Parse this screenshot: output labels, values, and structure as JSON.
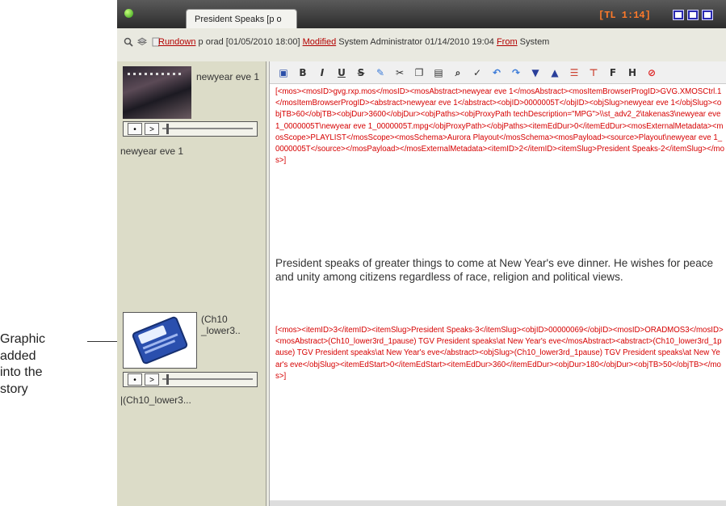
{
  "window": {
    "tab_title": "President Speaks [p o",
    "timecode": "[TL 1:14]"
  },
  "infobar": {
    "rundown_link": "Rundown",
    "rundown_detail": "p orad [01/05/2010 18:00]",
    "modified_link": "Modified",
    "modified_detail": "System Administrator  01/14/2010 19:04",
    "from_link": "From",
    "from_detail": "System"
  },
  "media_items": [
    {
      "thumb_label": "newyear eve 1",
      "caption": "newyear eve 1"
    },
    {
      "thumb_label": "(Ch10 _lower3..",
      "caption": "|(Ch10_lower3..."
    }
  ],
  "controls": {
    "play_label": "•",
    "next_label": ">"
  },
  "icons": {
    "toolbar": [
      "save-icon",
      "bold-icon",
      "italic-icon",
      "underline-icon",
      "strike-icon",
      "highlight-icon",
      "cut-icon",
      "copy-icon",
      "paste-icon",
      "find-icon",
      "spell-icon",
      "undo-icon",
      "redo-icon",
      "move-down-icon",
      "move-up-icon",
      "line-icon",
      "tab-icon",
      "footer-icon",
      "header-icon",
      "stop-icon"
    ]
  },
  "toolbar_labels": [
    "B",
    "I",
    "U",
    "S",
    "F",
    "H"
  ],
  "editor": {
    "mos_block_1": "[<mos><mosID>gvg.rxp.mos</mosID><mosAbstract>newyear eve 1</mosAbstract><mosItemBrowserProgID>GVG.XMOSCtrl.1</mosItemBrowserProgID><abstract>newyear eve 1</abstract><objID>0000005T</objID><objSlug>newyear eve 1</objSlug><objTB>60</objTB><objDur>3600</objDur><objPaths><objProxyPath techDescription=\"MPG\">\\\\st_adv2_2\\takenas3\\newyear eve 1_0000005T\\newyear eve 1_0000005T.mpg</objProxyPath></objPaths><itemEdDur>0</itemEdDur><mosExternalMetadata><mosScope>PLAYLIST</mosScope><mosSchema>Aurora Playout</mosSchema><mosPayload><source>Playout\\newyear eve 1_0000005T</source></mosPayload></mosExternalMetadata><itemID>2</itemID><itemSlug>President Speaks-2</itemSlug></mos>]",
    "story_text": "President speaks of greater things to come at New Year's eve dinner. He wishes for peace and unity among citizens regardless of race, religion and political views.",
    "mos_block_2": "[<mos><itemID>3</itemID><itemSlug>President Speaks-3</itemSlug><objID>00000069</objID><mosID>ORADMOS3</mosID><mosAbstract>(Ch10_lower3rd_1pause) TGV President speaks\\at New Year's eve</mosAbstract><abstract>(Ch10_lower3rd_1pause) TGV President speaks\\at New Year's eve</abstract><objSlug>(Ch10_lower3rd_1pause) TGV President speaks\\at New Year's eve</objSlug><itemEdStart>0</itemEdStart><itemEdDur>360</itemEdDur><objDur>180</objDur><objTB>50</objTB></mos>]"
  },
  "annotation": {
    "text_lines": [
      "Graphic",
      "added",
      "into the",
      "story"
    ]
  }
}
